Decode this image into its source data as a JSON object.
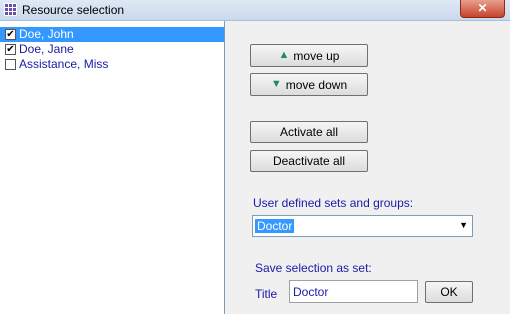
{
  "window": {
    "title": "Resource selection",
    "close_glyph": "✕"
  },
  "resources": [
    {
      "label": "Doe, John",
      "checked": true,
      "selected": true
    },
    {
      "label": "Doe, Jane",
      "checked": true,
      "selected": false
    },
    {
      "label": "Assistance, Miss",
      "checked": false,
      "selected": false
    }
  ],
  "buttons": {
    "move_up": "move up",
    "move_down": "move down",
    "activate_all": "Activate all",
    "deactivate_all": "Deactivate all",
    "ok": "OK"
  },
  "icons": {
    "up": "arrow-up-icon",
    "down": "arrow-down-icon"
  },
  "sets": {
    "label": "User defined sets and groups:",
    "selected": "Doctor"
  },
  "save": {
    "heading": "Save selection as set:",
    "title_label": "Title",
    "title_value": "Doctor"
  },
  "colors": {
    "selection": "#3399ff",
    "label_text": "#1a1aa6"
  }
}
